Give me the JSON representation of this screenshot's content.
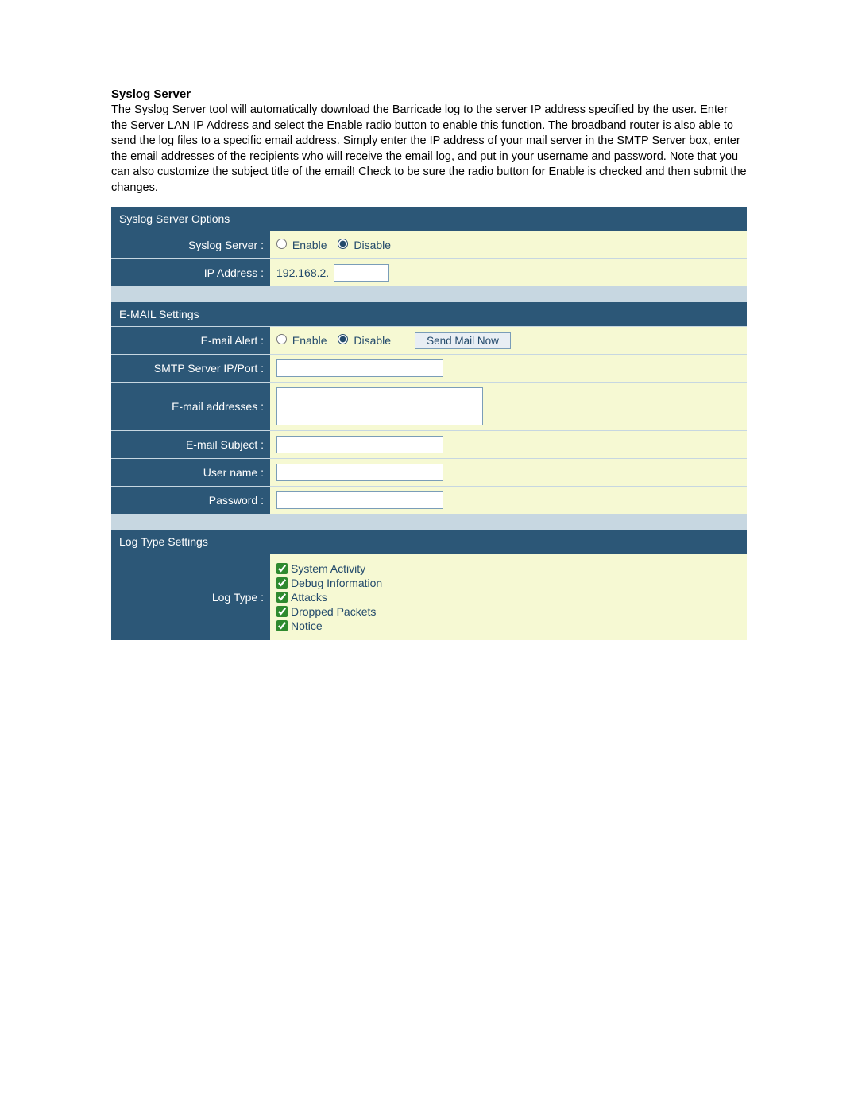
{
  "heading": "Syslog Server",
  "description": "The Syslog Server tool will automatically download the Barricade log to the server IP address specified by the user. Enter the Server LAN IP Address and select the Enable radio button to enable this function. The broadband router is also able to send the log files to a specific email address. Simply enter the IP address of your mail server in the SMTP Server box, enter the email addresses of the recipients who will receive the email log, and put in your username and password. Note that you can also customize the subject title of the email! Check to be sure the radio button for Enable is checked and then submit the changes.",
  "radio": {
    "enable": "Enable",
    "disable": "Disable"
  },
  "syslog": {
    "title": "Syslog Server Options",
    "server_label": "Syslog Server :",
    "server_selected": "disable",
    "ip_label": "IP Address :",
    "ip_prefix": "192.168.2.",
    "ip_suffix": ""
  },
  "email": {
    "title": "E-MAIL Settings",
    "alert_label": "E-mail Alert :",
    "alert_selected": "disable",
    "send_button": "Send Mail Now",
    "smtp_label": "SMTP Server IP/Port :",
    "smtp_value": "",
    "addresses_label": "E-mail addresses :",
    "addresses_value": "",
    "subject_label": "E-mail Subject :",
    "subject_value": "",
    "username_label": "User name :",
    "username_value": "",
    "password_label": "Password :",
    "password_value": ""
  },
  "logtype": {
    "title": "Log Type Settings",
    "label": "Log Type :",
    "options": [
      {
        "label": "System Activity",
        "checked": true
      },
      {
        "label": "Debug Information",
        "checked": true
      },
      {
        "label": "Attacks",
        "checked": true
      },
      {
        "label": "Dropped Packets",
        "checked": true
      },
      {
        "label": "Notice",
        "checked": true
      }
    ]
  }
}
